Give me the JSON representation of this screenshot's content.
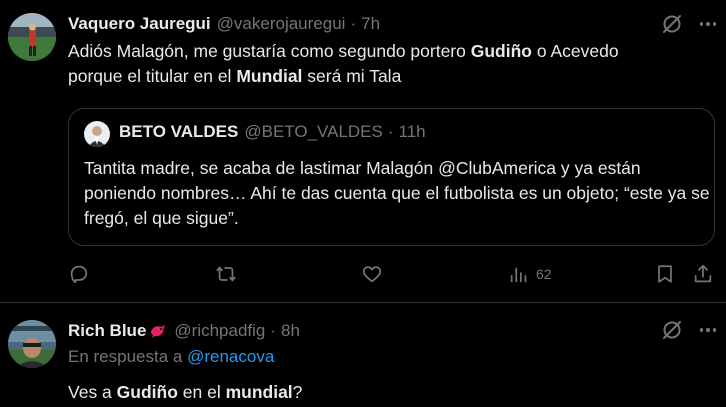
{
  "tweet1": {
    "name": "Vaquero Jauregui",
    "handle": "@vakerojauregui",
    "dot": "·",
    "time": "7h",
    "text_line1_a": "Adiós Malagón, me gustaría como segundo portero ",
    "text_line1_b": "Gudiño",
    "text_line1_c": " o Acevedo",
    "text_line2_a": "porque el titular en el ",
    "text_line2_b": "Mundial",
    "text_line2_c": " será mi Tala",
    "quote": {
      "name": "BETO VALDES",
      "handle": "@BETO_VALDES",
      "dot": "·",
      "time": "11h",
      "text": "Tantita madre, se acaba de lastimar Malagón @ClubAmerica y ya están poniendo nombres… Ahí te das cuenta que el futbolista es un objeto; “este ya se fregó, el que sigue”."
    },
    "views": "62"
  },
  "tweet2": {
    "name": "Rich Blue",
    "handle": "@richpadfig",
    "dot": "·",
    "time": "8h",
    "reply_prefix": "En respuesta a ",
    "reply_mention": "@renacova",
    "text_a": "Ves a ",
    "text_b": "Gudiño",
    "text_c": " en el ",
    "text_d": "mundial",
    "text_e": "?"
  },
  "colors": {
    "accent": "#1d9bf0",
    "muted": "#71767b",
    "border": "#2f3336",
    "bird": "#e0245e"
  }
}
